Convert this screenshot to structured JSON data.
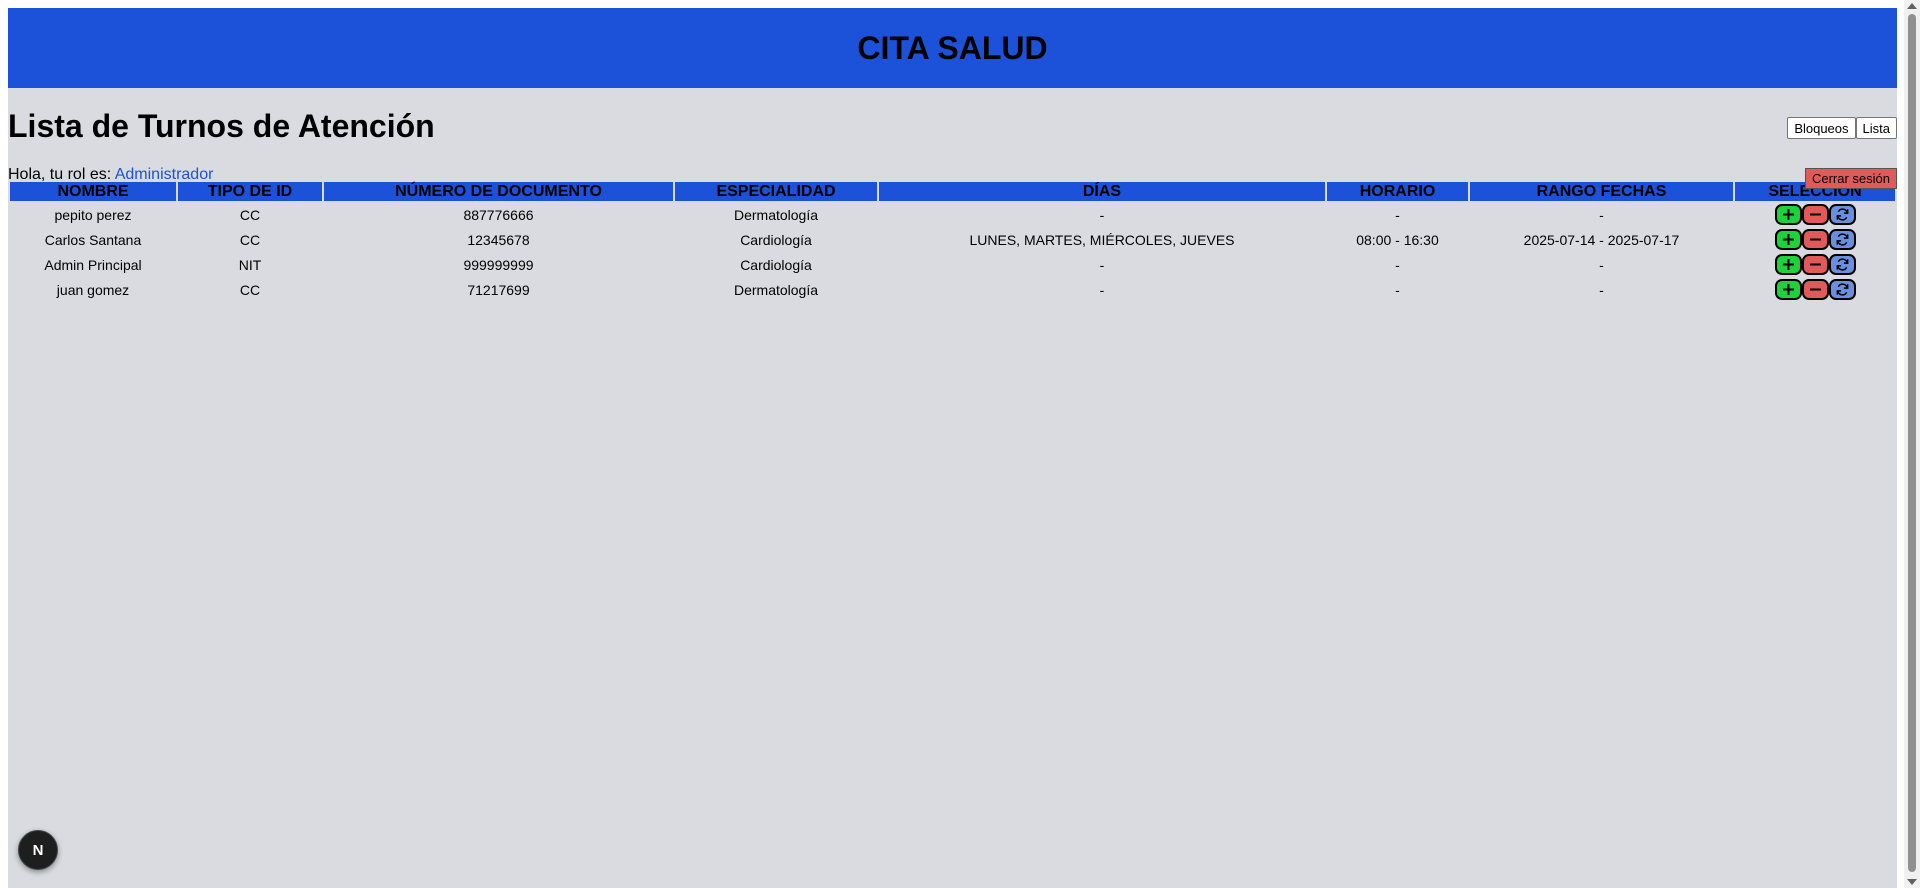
{
  "header": {
    "title": "CITA SALUD"
  },
  "page": {
    "title": "Lista de Turnos de Atención"
  },
  "nav": {
    "bloqueos_label": "Bloqueos",
    "lista_label": "Lista"
  },
  "greeting": {
    "prefix": "Hola, tu rol es: ",
    "role": "Administrador"
  },
  "logout": {
    "label": "Cerrar sesión"
  },
  "table": {
    "columns": [
      "NOMBRE",
      "TIPO DE ID",
      "NÚMERO DE DOCUMENTO",
      "ESPECIALIDAD",
      "DÍAS",
      "HORARIO",
      "RANGO FECHAS",
      "SELECCIÓN"
    ],
    "rows": [
      {
        "nombre": "pepito perez",
        "tipo_id": "CC",
        "documento": "887776666",
        "especialidad": "Dermatología",
        "dias": "-",
        "horario": "-",
        "rango": "-"
      },
      {
        "nombre": "Carlos Santana",
        "tipo_id": "CC",
        "documento": "12345678",
        "especialidad": "Cardiología",
        "dias": "LUNES, MARTES, MIÉRCOLES, JUEVES",
        "horario": "08:00 - 16:30",
        "rango": "2025-07-14 - 2025-07-17"
      },
      {
        "nombre": "Admin Principal",
        "tipo_id": "NIT",
        "documento": "999999999",
        "especialidad": "Cardiología",
        "dias": "-",
        "horario": "-",
        "rango": "-"
      },
      {
        "nombre": "juan gomez",
        "tipo_id": "CC",
        "documento": "71217699",
        "especialidad": "Dermatología",
        "dias": "-",
        "horario": "-",
        "rango": "-"
      }
    ]
  },
  "actions": {
    "add_icon": "plus-icon",
    "remove_icon": "minus-icon",
    "refresh_icon": "refresh-icon"
  },
  "colors": {
    "brand": "#1c52d9",
    "background": "#dadbe0",
    "add": "#1fd13a",
    "remove": "#e05a5a",
    "refresh": "#6a8ee0"
  },
  "badge": {
    "label": "N"
  }
}
